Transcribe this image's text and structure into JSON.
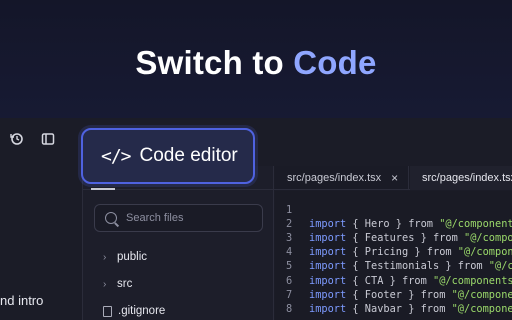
{
  "hero": {
    "title_prefix": "Switch to ",
    "title_accent": "Code"
  },
  "colors": {
    "accent": "#8fa6ff",
    "badge_border": "#4f62e0",
    "keyword": "#7d9bff",
    "string": "#9ad86a"
  },
  "leftbar": {
    "partial_text": "nd intro",
    "icons": [
      "refresh-icon",
      "sidebar-toggle-icon"
    ]
  },
  "badge": {
    "icon": "</>",
    "label": "Code editor"
  },
  "explorer": {
    "search_placeholder": "Search files",
    "items": [
      {
        "label": "public",
        "type": "folder"
      },
      {
        "label": "src",
        "type": "folder"
      },
      {
        "label": ".gitignore",
        "type": "file"
      }
    ]
  },
  "tabs": [
    {
      "label": "src/pages/index.tsx",
      "close": "×"
    },
    {
      "label": "src/pages/index.tsx"
    }
  ],
  "code": {
    "line_numbers": [
      "1",
      "2",
      "3",
      "4",
      "5",
      "6",
      "7",
      "8"
    ],
    "lines": [
      {
        "kw": "",
        "mid": "",
        "str": ""
      },
      {
        "kw": "import",
        "mid": " { Hero } from ",
        "str": "\"@/components"
      },
      {
        "kw": "import",
        "mid": " { Features } from ",
        "str": "\"@/compon"
      },
      {
        "kw": "import",
        "mid": " { Pricing } from ",
        "str": "\"@/compone"
      },
      {
        "kw": "import",
        "mid": " { Testimonials } from ",
        "str": "\"@/co"
      },
      {
        "kw": "import",
        "mid": " { CTA } from ",
        "str": "\"@/components"
      },
      {
        "kw": "import",
        "mid": " { Footer } from ",
        "str": "\"@/compone"
      },
      {
        "kw": "import",
        "mid": " { Navbar } from ",
        "str": "\"@/compone"
      }
    ]
  }
}
